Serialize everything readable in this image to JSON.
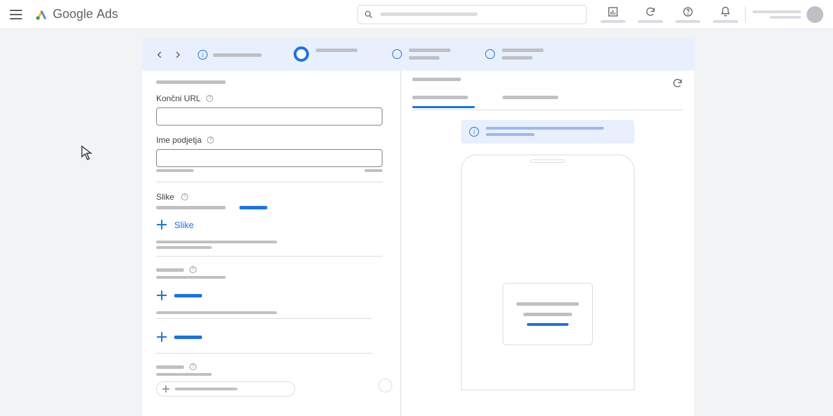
{
  "header": {
    "product_name_1": "Google",
    "product_name_2": "Ads"
  },
  "form": {
    "final_url_label": "Končni URL",
    "business_name_label": "Ime podjetja",
    "images_label": "Slike",
    "add_images_button": "Slike"
  }
}
